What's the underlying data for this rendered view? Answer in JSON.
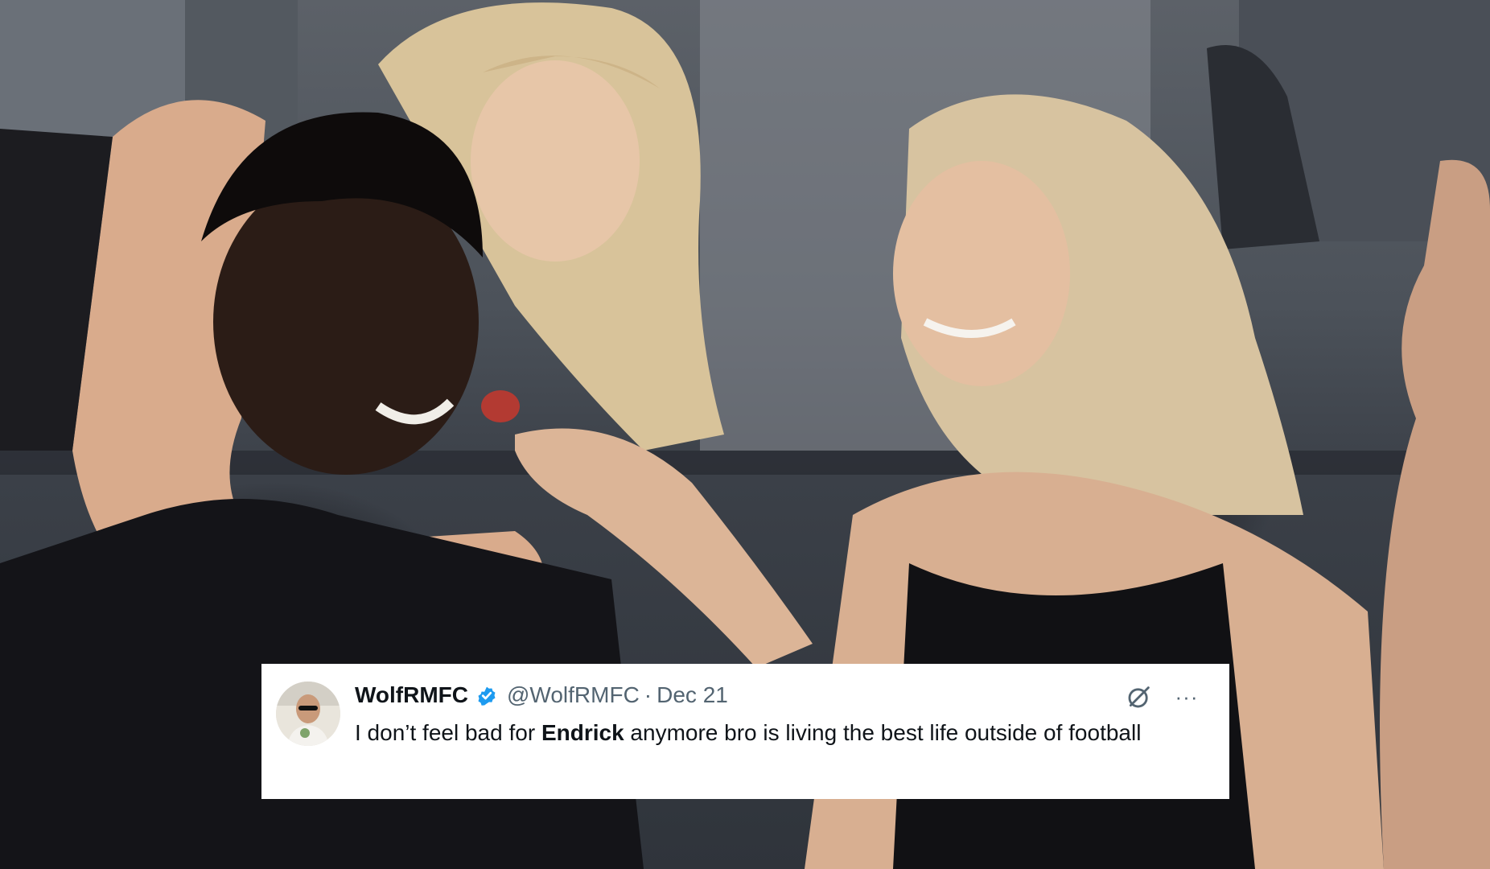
{
  "tweet": {
    "display_name": "WolfRMFC",
    "handle": "@WolfRMFC",
    "separator": "·",
    "date": "Dec 21",
    "text_before": "I don’t feel bad for ",
    "text_bold": "Endrick",
    "text_after": " anymore bro is living the best life outside of football",
    "more_label": "···",
    "icons": {
      "verified": "verified-badge-icon",
      "grok": "grok-icon",
      "more": "more-options-icon"
    }
  },
  "colors": {
    "verified_blue": "#1d9bf0",
    "text_primary": "#0f1419",
    "text_secondary": "#536471",
    "card_bg": "#ffffff"
  }
}
